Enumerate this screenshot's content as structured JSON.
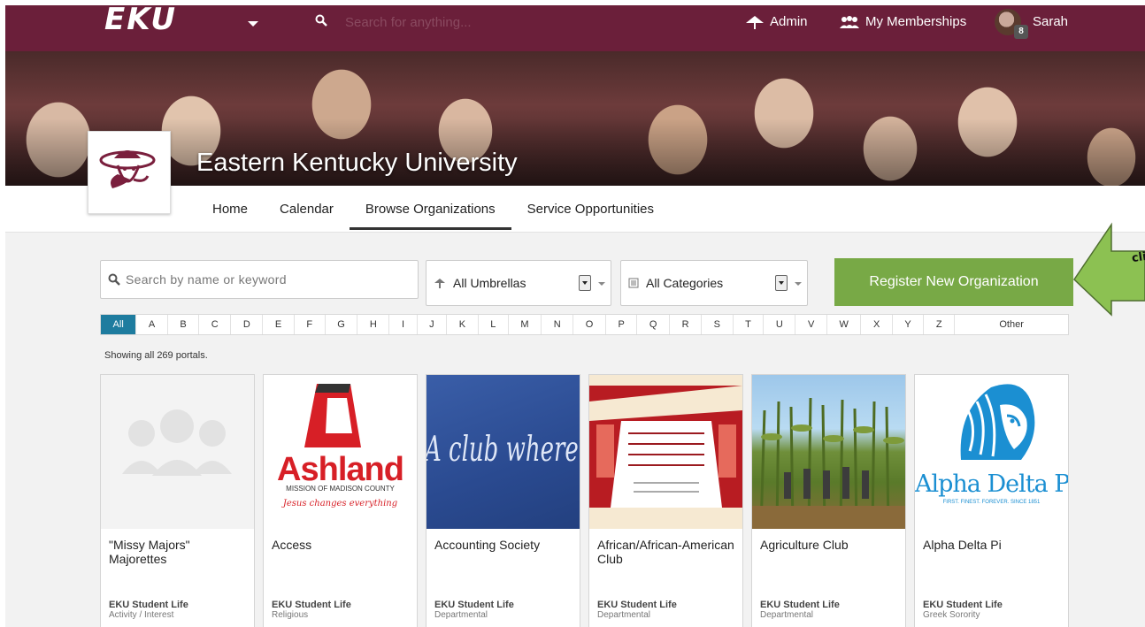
{
  "topbar": {
    "logo": "EKU",
    "search_placeholder": "Search for anything...",
    "admin_label": "Admin",
    "memberships_label": "My Memberships",
    "user_name": "Sarah",
    "notification_count": "8",
    "colors": {
      "bar": "#6b1f3a"
    }
  },
  "header": {
    "title": "Eastern Kentucky University",
    "tabs": [
      {
        "label": "Home"
      },
      {
        "label": "Calendar"
      },
      {
        "label": "Browse Organizations",
        "active": true
      },
      {
        "label": "Service Opportunities"
      }
    ]
  },
  "filters": {
    "keyword_placeholder": "Search by name or keyword",
    "umbrella_value": "All Umbrellas",
    "category_value": "All Categories",
    "register_label": "Register New Organization",
    "callout_text": "cli",
    "colors": {
      "register": "#78a946",
      "alpha_active": "#1e7c9f"
    }
  },
  "alphabet": [
    "All",
    "A",
    "B",
    "C",
    "D",
    "E",
    "F",
    "G",
    "H",
    "I",
    "J",
    "K",
    "L",
    "M",
    "N",
    "O",
    "P",
    "Q",
    "R",
    "S",
    "T",
    "U",
    "V",
    "W",
    "X",
    "Y",
    "Z",
    "Other"
  ],
  "showing_text": "Showing all 269 portals.",
  "cards": [
    {
      "name": "\"Missy Majors\" Majorettes",
      "umbrella": "EKU Student Life",
      "category": "Activity / Interest"
    },
    {
      "name": "Access",
      "umbrella": "EKU Student Life",
      "category": "Religious",
      "logo": {
        "brand": "Ashland",
        "sub": "MISSION OF MADISON COUNTY",
        "tagline": "Jesus changes everything"
      }
    },
    {
      "name": "Accounting Society",
      "umbrella": "EKU Student Life",
      "category": "Departmental",
      "image_text": "A club where everyone coun"
    },
    {
      "name": "African/African-American Club",
      "umbrella": "EKU Student Life",
      "category": "Departmental"
    },
    {
      "name": "Agriculture Club",
      "umbrella": "EKU Student Life",
      "category": "Departmental"
    },
    {
      "name": "Alpha Delta Pi",
      "umbrella": "EKU Student Life",
      "category": "Greek Sorority",
      "logo": {
        "brand": "Alpha Delta Pi",
        "tagline": "FIRST. FINEST. FOREVER. SINCE 1851"
      }
    }
  ]
}
